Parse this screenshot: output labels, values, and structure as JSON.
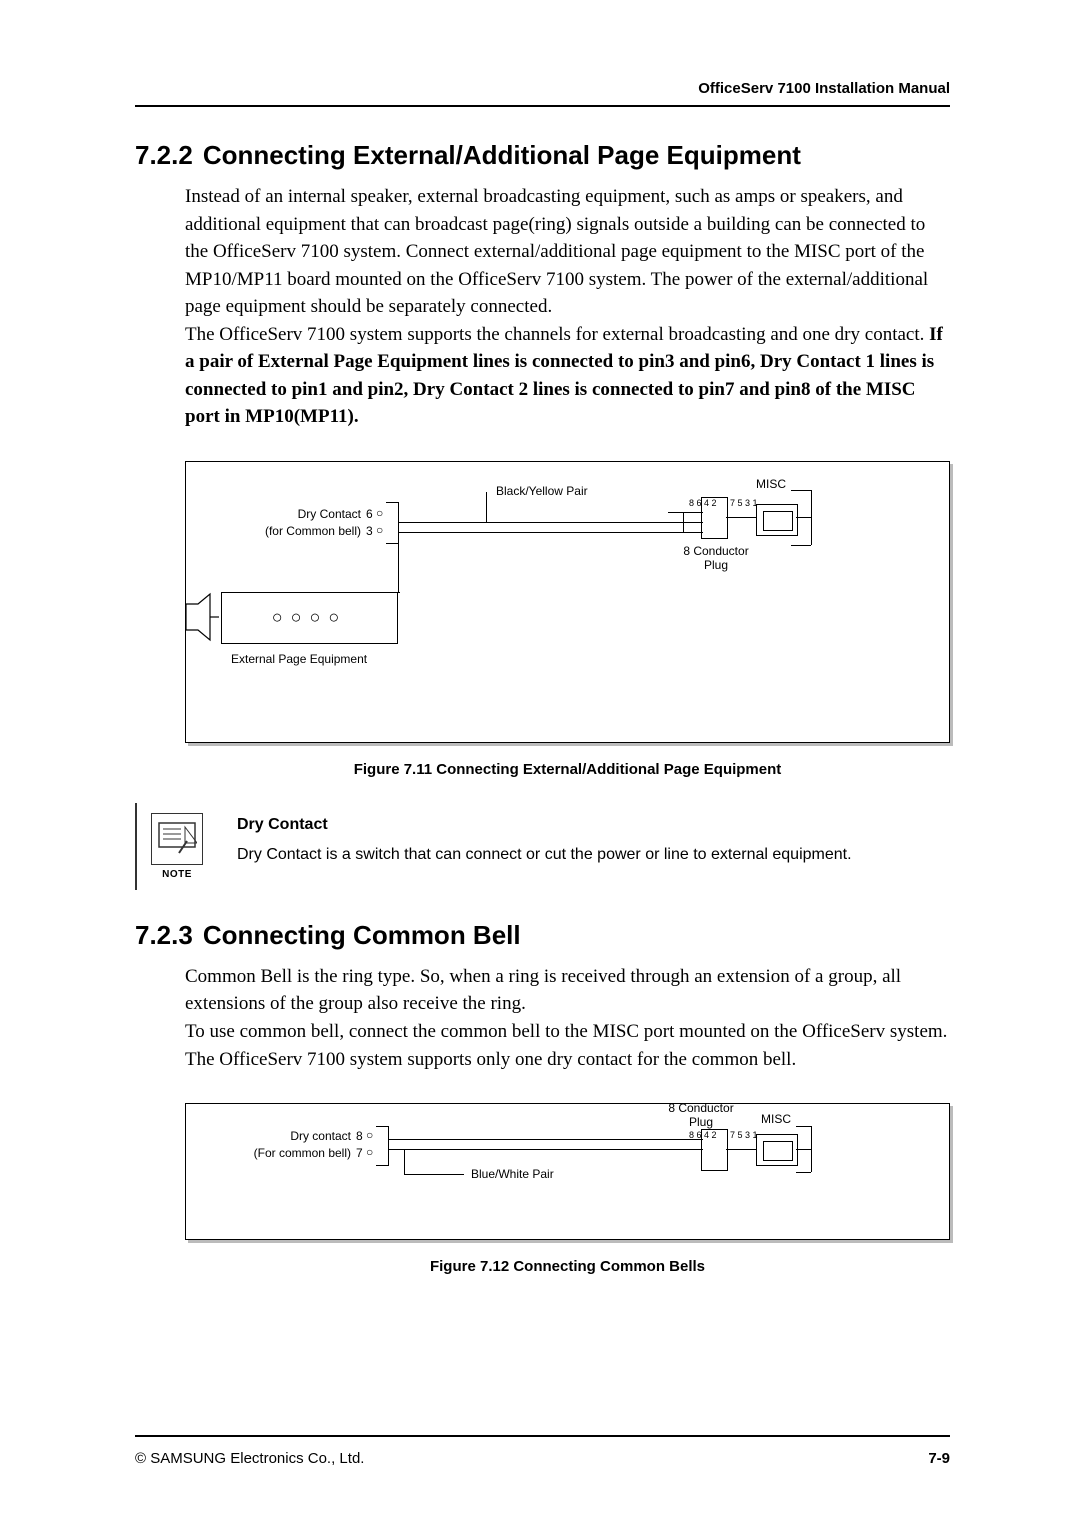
{
  "header": {
    "doc_title": "OfficeServ 7100 Installation Manual"
  },
  "footer": {
    "copyright": "© SAMSUNG Electronics Co., Ltd.",
    "page_num": "7-9"
  },
  "s722": {
    "num": "7.2.2",
    "title": "Connecting External/Additional Page Equipment",
    "para_a": "Instead of an internal speaker, external broadcasting equipment, such as amps or speakers, and additional equipment that can broadcast page(ring) signals outside a building can be connected to the OfficeServ 7100 system. Connect external/additional page equipment to the MISC port of the MP10/MP11 board mounted on the OfficeServ 7100 system. The power of the external/additional page equipment should be separately connected.",
    "para_b": "The OfficeServ 7100 system supports the channels for external broadcasting and one dry contact. ",
    "para_c_bold": "If a pair of External Page Equipment lines is connected to pin3 and pin6, Dry Contact 1 lines is connected to pin1 and pin2, Dry Contact 2 lines is connected to pin7 and pin8 of the MISC port in MP10(MP11)."
  },
  "fig711": {
    "caption": "Figure 7.11    Connecting External/Additional Page Equipment",
    "labels": {
      "dry_contact_line1": "Dry Contact",
      "dry_contact_line2": "(for Common bell)",
      "pin6": "6",
      "pin3": "3",
      "pair": "Black/Yellow Pair",
      "ext_eq": "External Page Equipment",
      "plug": "8 Conductor\nPlug",
      "misc": "MISC",
      "pins_right": "8\n6\n4\n2",
      "pins_left": "7\n5\n3\n1"
    }
  },
  "note": {
    "label": "NOTE",
    "title": "Dry Contact",
    "body": "Dry Contact is a switch that can connect or cut the power or line to external equipment."
  },
  "s723": {
    "num": "7.2.3",
    "title": "Connecting Common Bell",
    "para": "Common Bell is the ring type. So, when a ring is received through an extension of a group, all extensions of the group also receive the ring.\nTo use common bell, connect the common bell to the MISC port mounted on the OfficeServ system. The OfficeServ 7100 system supports only one dry contact for the common bell."
  },
  "fig712": {
    "caption": "Figure 7.12    Connecting Common Bells",
    "labels": {
      "dry_contact_line1": "Dry contact",
      "dry_contact_line2": "(For common bell)",
      "pin8": "8",
      "pin7": "7",
      "pair": "Blue/White Pair",
      "plug": "8 Conductor\nPlug",
      "misc": "MISC",
      "pins_right": "8\n6\n4\n2",
      "pins_left": "7\n5\n3\n1"
    }
  }
}
